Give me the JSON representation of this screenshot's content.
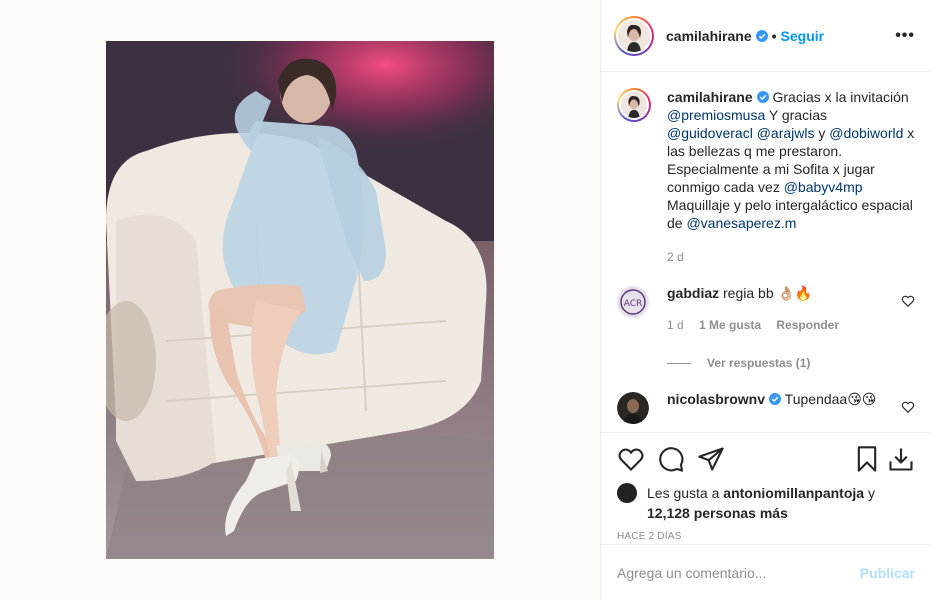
{
  "post": {
    "username": "camilahirane",
    "follow_label": "Seguir",
    "more_label": "•••",
    "dot": "•"
  },
  "caption": {
    "username": "camilahirane",
    "t1": "Gracias x la invitación ",
    "m1": "@premiosmusa",
    "t2": " Y gracias ",
    "m2": "@guidoveracl",
    "m3": "@arajwls",
    "t3": " y ",
    "m4": "@dobiworld",
    "t4": " x las bellezas q me prestaron. Especialmente a mi Sofita x jugar conmigo cada vez ",
    "m5": "@babyv4mp",
    "t5": " Maquillaje y pelo intergaláctico espacial de ",
    "m6": "@vanesaperez.m",
    "time": "2 d"
  },
  "comments": [
    {
      "username": "gabdiaz",
      "text": "regia bb 👌🏼🔥",
      "time": "1 d",
      "likes": "1 Me gusta",
      "reply": "Responder",
      "view_replies": "Ver respuestas (1)"
    },
    {
      "username": "nicolasbrownv",
      "text": "Tupendaa😘😘"
    }
  ],
  "likes": {
    "prefix": "Les gusta a ",
    "user": "antoniomillanpantoja",
    "mid": " y ",
    "count": "12,128 personas más"
  },
  "time_ago": "HACE 2 DÍAS",
  "add_comment": {
    "placeholder": "Agrega un comentario...",
    "publish_label": "Publicar"
  },
  "colors": {
    "accent": "#0095f6",
    "mention": "#00376b",
    "muted": "#8e8e8e"
  }
}
